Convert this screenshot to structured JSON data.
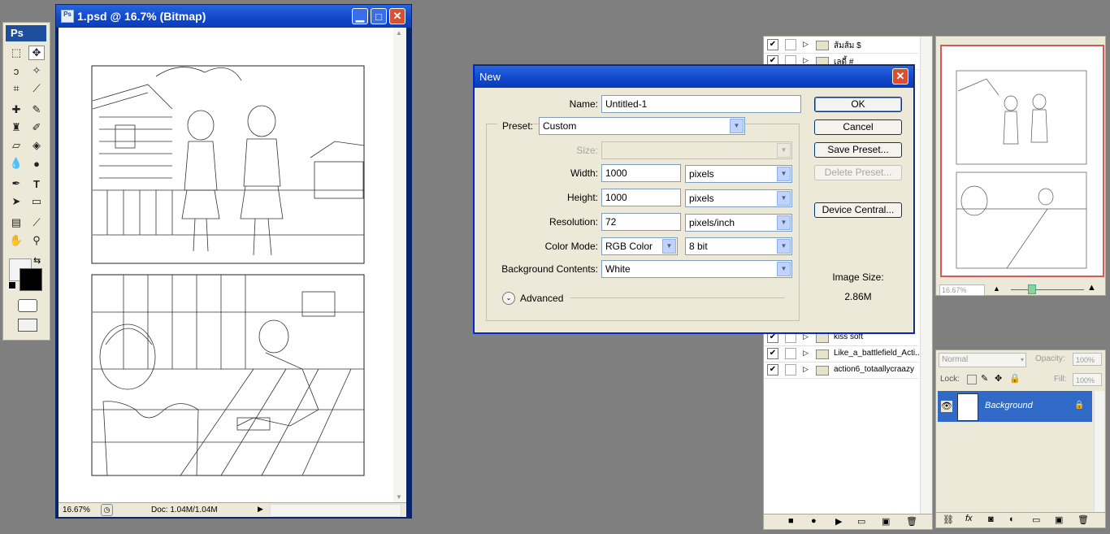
{
  "toolbox": {
    "logo": "Ps"
  },
  "document": {
    "title": "1.psd @ 16.7% (Bitmap)",
    "zoom": "16.67%",
    "doc_info": "Doc: 1.04M/1.04M"
  },
  "layers_list": {
    "rows": [
      {
        "name": "ส้มส้ม $"
      },
      {
        "name": "เลดี้ #"
      },
      {
        "name": "kiss  soft"
      },
      {
        "name": "Like_a_battlefield_Acti..."
      },
      {
        "name": "action6_totaallycraazy"
      }
    ]
  },
  "navigator": {
    "zoom": "16.67%"
  },
  "layers_panel": {
    "blend_mode": "Normal",
    "opacity_label": "Opacity:",
    "opacity_value": "100%",
    "lock_label": "Lock:",
    "fill_label": "Fill:",
    "fill_value": "100%",
    "layer_name": "Background"
  },
  "dialog": {
    "title": "New",
    "name_label": "Name:",
    "name_value": "Untitled-1",
    "preset_label": "Preset:",
    "preset_value": "Custom",
    "size_label": "Size:",
    "width_label": "Width:",
    "width_value": "1000",
    "width_unit": "pixels",
    "height_label": "Height:",
    "height_value": "1000",
    "height_unit": "pixels",
    "resolution_label": "Resolution:",
    "resolution_value": "72",
    "resolution_unit": "pixels/inch",
    "color_mode_label": "Color Mode:",
    "color_mode_value": "RGB Color",
    "bit_depth": "8 bit",
    "bg_label": "Background Contents:",
    "bg_value": "White",
    "advanced_label": "Advanced",
    "ok": "OK",
    "cancel": "Cancel",
    "save_preset": "Save Preset...",
    "delete_preset": "Delete Preset...",
    "device_central": "Device Central...",
    "image_size_label": "Image Size:",
    "image_size_value": "2.86M"
  }
}
